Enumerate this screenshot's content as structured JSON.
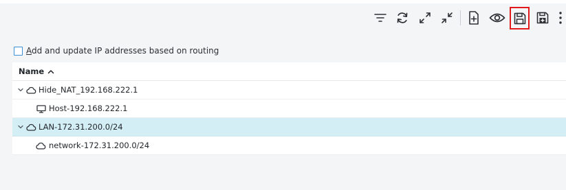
{
  "toolbar": {
    "buttons": [
      {
        "icon": "filter-icon",
        "label": "Filter"
      },
      {
        "icon": "refresh-icon",
        "label": "Refresh"
      },
      {
        "icon": "expand-all-icon",
        "label": "Expand all"
      },
      {
        "icon": "collapse-all-icon",
        "label": "Collapse all"
      },
      {
        "icon": "new-document-icon",
        "label": "New"
      },
      {
        "icon": "eye-icon",
        "label": "View"
      },
      {
        "icon": "save-icon",
        "label": "Save",
        "highlighted": true
      },
      {
        "icon": "save-as-icon",
        "label": "Save as"
      },
      {
        "icon": "more-icon",
        "label": "More"
      }
    ],
    "highlight_color": "#e0191d"
  },
  "checkbox": {
    "mnemonic": "A",
    "rest": "dd and update IP addresses based on routing",
    "checked": false
  },
  "tree": {
    "header": {
      "name": "Name",
      "sort": "ascending"
    },
    "rows": [
      {
        "label": "Hide_NAT_192.168.222.1",
        "icon": "cloud-icon",
        "level": 0,
        "expanded": true,
        "selected": false
      },
      {
        "label": "Host-192.168.222.1",
        "icon": "monitor-icon",
        "level": 1,
        "expanded": null,
        "selected": false
      },
      {
        "label": "LAN-172.31.200.0/24",
        "icon": "cloud-icon",
        "level": 0,
        "expanded": true,
        "selected": true
      },
      {
        "label": "network-172.31.200.0/24",
        "icon": "cloud-icon",
        "level": 1,
        "expanded": null,
        "selected": false
      }
    ],
    "selected_color": "#d4eef6"
  }
}
